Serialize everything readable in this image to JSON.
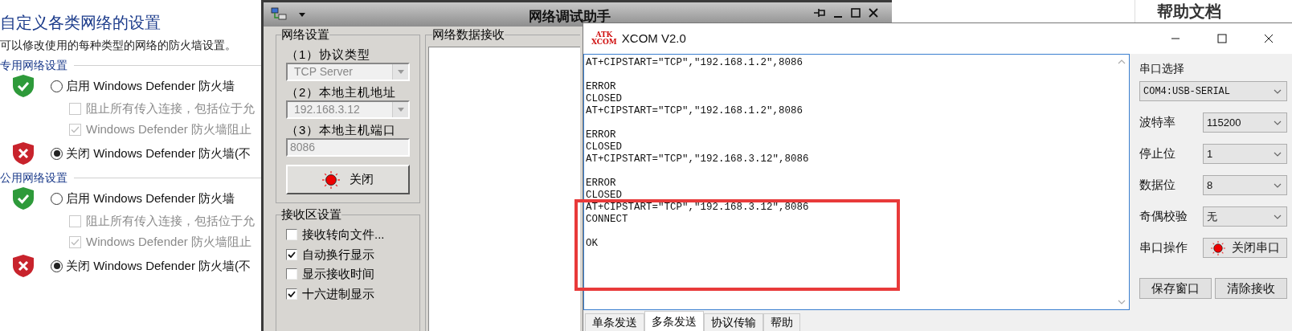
{
  "firewall": {
    "title": "自定义各类网络的设置",
    "subtitle": "可以修改使用的每种类型的网络的防火墙设置。",
    "sections": [
      {
        "title": "专用网络设置",
        "options": [
          {
            "label": "启用 Windows Defender 防火墙",
            "selected": false,
            "children": [
              {
                "label": "阻止所有传入连接，包括位于允",
                "checked": false,
                "disabled": true
              },
              {
                "label": "Windows Defender 防火墙阻止",
                "checked": true,
                "disabled": true
              }
            ]
          },
          {
            "label": "关闭 Windows Defender 防火墙(不",
            "selected": true
          }
        ]
      },
      {
        "title": "公用网络设置",
        "options": [
          {
            "label": "启用 Windows Defender 防火墙",
            "selected": false,
            "children": [
              {
                "label": "阻止所有传入连接，包括位于允",
                "checked": false,
                "disabled": true
              },
              {
                "label": "Windows Defender 防火墙阻止",
                "checked": true,
                "disabled": true
              }
            ]
          },
          {
            "label": "关闭 Windows Defender 防火墙(不",
            "selected": true
          }
        ]
      }
    ]
  },
  "netassist": {
    "title": "网络调试助手",
    "settings_group": {
      "title": "网络设置",
      "fields": [
        {
          "label": "（1）协议类型",
          "value": "TCP Server",
          "kind": "select",
          "disabled": true
        },
        {
          "label": "（2）本地主机地址",
          "value": "192.168.3.12",
          "kind": "select",
          "disabled": true
        },
        {
          "label": "（3）本地主机端口",
          "value": "8086",
          "kind": "input",
          "disabled": true
        }
      ],
      "button": "关闭"
    },
    "receive_group": {
      "title": "接收区设置",
      "options": [
        {
          "label": "接收转向文件...",
          "checked": false
        },
        {
          "label": "自动换行显示",
          "checked": true
        },
        {
          "label": "显示接收时间",
          "checked": false
        },
        {
          "label": "十六进制显示",
          "checked": true
        }
      ]
    },
    "receive_area": {
      "title": "网络数据接收"
    }
  },
  "xcom": {
    "title": "XCOM V2.0",
    "logo_top": "ATK",
    "logo_bottom": "XCOM",
    "blocks": [
      [
        "AT+CIPSTART=\"TCP\",\"192.168.1.2\",8086"
      ],
      [
        "ERROR",
        "CLOSED",
        "AT+CIPSTART=\"TCP\",\"192.168.1.2\",8086"
      ],
      [
        "ERROR",
        "CLOSED",
        "AT+CIPSTART=\"TCP\",\"192.168.3.12\",8086"
      ],
      [
        "ERROR",
        "CLOSED",
        "AT+CIPSTART=\"TCP\",\"192.168.3.12\",8086",
        "CONNECT"
      ],
      [
        "OK"
      ]
    ],
    "tabs": [
      {
        "label": "单条发送",
        "selected": false
      },
      {
        "label": "多条发送",
        "selected": true
      },
      {
        "label": "协议传输",
        "selected": false
      },
      {
        "label": "帮助",
        "selected": false
      }
    ],
    "panel": {
      "port_label": "串口选择",
      "port": "COM4:USB-SERIAL",
      "settings": [
        {
          "label": "波特率",
          "value": "115200"
        },
        {
          "label": "停止位",
          "value": "1"
        },
        {
          "label": "数据位",
          "value": "8"
        },
        {
          "label": "奇偶校验",
          "value": "无"
        }
      ],
      "operation_label": "串口操作",
      "operation_button": "关闭串口",
      "buttons": [
        "保存窗口",
        "清除接收"
      ]
    }
  },
  "help_doc": {
    "title": "帮助文档"
  }
}
